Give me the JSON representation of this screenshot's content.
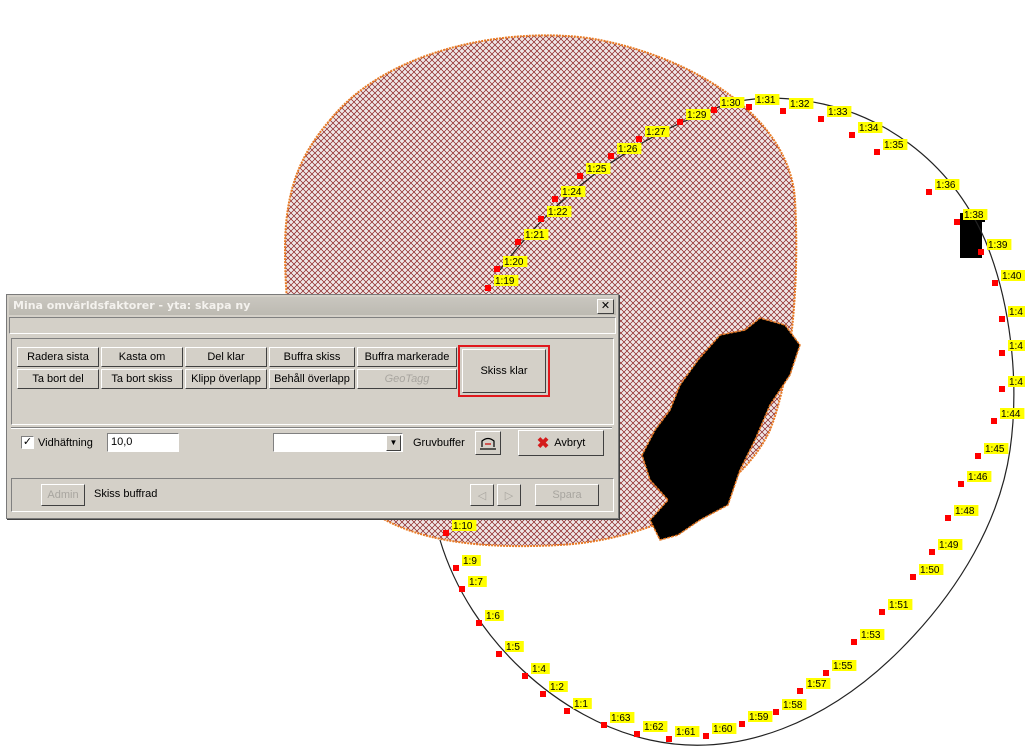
{
  "dialog": {
    "title": "Mina omvärldsfaktorer - yta: skapa ny",
    "close_glyph": "✕",
    "toolbar": {
      "row1": [
        "Radera sista",
        "Kasta om",
        "Del klar",
        "Buffra skiss",
        "Buffra markerade"
      ],
      "row2": [
        "Ta bort del",
        "Ta bort skiss",
        "Klipp överlapp",
        "Behåll överlapp",
        "GeoTagg"
      ],
      "finish_label": "Skiss klar"
    },
    "options": {
      "snap_checked_glyph": "✓",
      "snap_label": "Vidhäftning",
      "snap_value": "10,0",
      "dropdown_value": "",
      "mine_buffer_label": "Gruvbuffer",
      "cancel_label": "Avbryt"
    },
    "status": {
      "admin_label": "Admin",
      "message": "Skiss buffrad",
      "prev_glyph": "◁",
      "next_glyph": "▷",
      "save_label": "Spara"
    }
  },
  "map": {
    "point_labels": [
      "1:1",
      "1:2",
      "1:4",
      "1:5",
      "1:6",
      "1:7",
      "1:9",
      "1:10",
      "1:19",
      "1:20",
      "1:21",
      "1:22",
      "1:24",
      "1:25",
      "1:26",
      "1:27",
      "1:29",
      "1:30",
      "1:31",
      "1:32",
      "1:33",
      "1:34",
      "1:35",
      "1:36",
      "1:38",
      "1:39",
      "1:40",
      "1:4",
      "1:4",
      "1:4",
      "1:44",
      "1:45",
      "1:46",
      "1:48",
      "1:49",
      "1:50",
      "1:51",
      "1:53",
      "1:55",
      "1:57",
      "1:58",
      "1:59",
      "1:60",
      "1:61",
      "1:62",
      "1:63"
    ],
    "colors": {
      "label_bg": "#ffff00",
      "point": "#ff0000",
      "hatch": "#8a1e1e",
      "buffer_edge": "#e87a24"
    }
  }
}
